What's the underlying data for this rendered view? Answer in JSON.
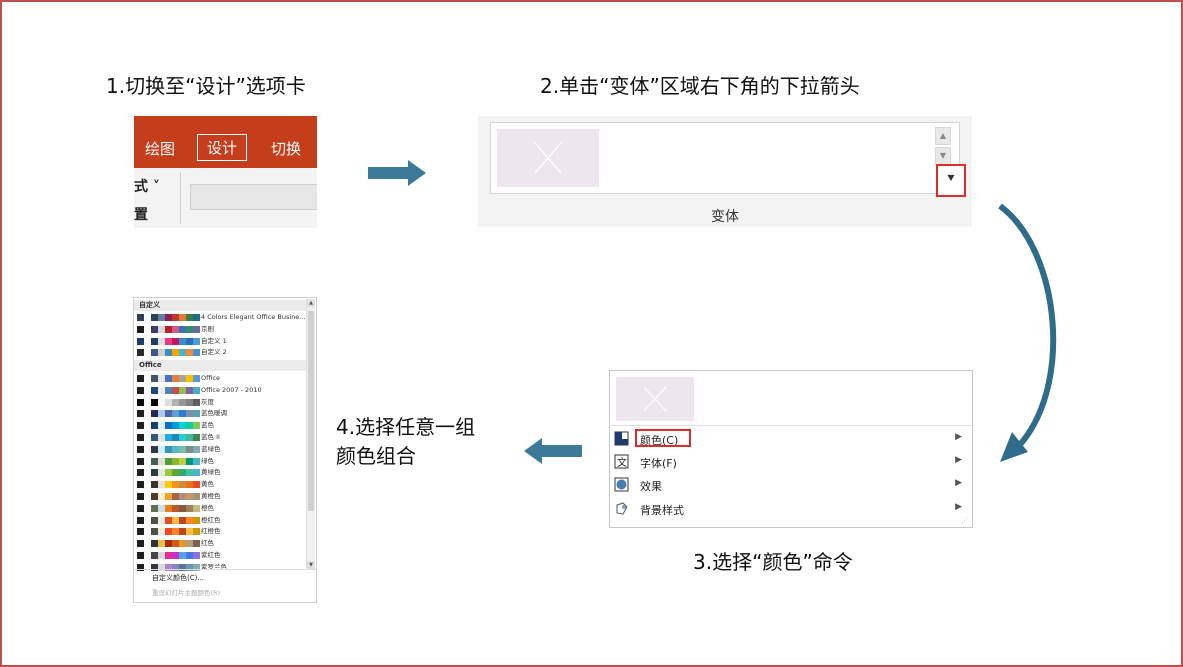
{
  "steps": {
    "s1": "1.切换至“设计”选项卡",
    "s2": "2.单击“变体”区域右下角的下拉箭头",
    "s3": "3.选择“颜色”命令",
    "s4_line1": "4.选择任意一组",
    "s4_line2": "颜色组合"
  },
  "ribbon": {
    "tab_draw": "绘图",
    "tab_design": "设计",
    "tab_transition": "切换",
    "lower_label1": "式 ˅",
    "lower_label2": "置"
  },
  "variants": {
    "group_label": "变体",
    "more_glyph": "⯆"
  },
  "menu": {
    "items": [
      {
        "label": "颜色(C)",
        "icon": "color-palette-icon"
      },
      {
        "label": "字体(F)",
        "icon": "font-icon"
      },
      {
        "label": "效果",
        "icon": "effects-icon"
      },
      {
        "label": "背景样式",
        "icon": "background-style-icon"
      }
    ]
  },
  "colors": {
    "header_custom": "自定义",
    "header_office": "Office",
    "custom": [
      {
        "name": "4 Colors Elegant Office Busine...",
        "sw": [
          "#2e4057",
          "#ffffff",
          "#2e4057",
          "#5b7fa6",
          "#8b2252",
          "#c0392b",
          "#e07b39",
          "#3a7d44",
          "#1f6f8b"
        ]
      },
      {
        "name": "京剧",
        "sw": [
          "#1c1c1c",
          "#ffffff",
          "#3d3d6b",
          "#d9d9d9",
          "#b5222b",
          "#d45a8c",
          "#3f6fae",
          "#2f8f66",
          "#6b6b9e"
        ]
      },
      {
        "name": "自定义 1",
        "sw": [
          "#1f3b6b",
          "#ffffff",
          "#1f3b6b",
          "#e0e0e0",
          "#e53b86",
          "#c2185b",
          "#3b8bd1",
          "#2c6fb8",
          "#4f9bd8"
        ]
      },
      {
        "name": "自定义 2",
        "sw": [
          "#2a2a2a",
          "#ffffff",
          "#3b5a8a",
          "#cfcfcf",
          "#3c8dbc",
          "#f0a500",
          "#4bb3c8",
          "#ef8b3b",
          "#4a8fd1"
        ]
      }
    ],
    "office": [
      {
        "name": "Office",
        "sw": [
          "#1f1f1f",
          "#ffffff",
          "#44546a",
          "#e7e6e6",
          "#4472c4",
          "#ed7d31",
          "#a5a5a5",
          "#ffc000",
          "#5b9bd5"
        ]
      },
      {
        "name": "Office 2007 - 2010",
        "sw": [
          "#1f1f1f",
          "#ffffff",
          "#1f497d",
          "#eeece1",
          "#4f81bd",
          "#c0504d",
          "#9bbb59",
          "#8064a2",
          "#4bacc6"
        ]
      },
      {
        "name": "灰度",
        "sw": [
          "#000000",
          "#ffffff",
          "#000000",
          "#f8f8f8",
          "#dddddd",
          "#b2b2b2",
          "#969696",
          "#808080",
          "#5f5f5f"
        ]
      },
      {
        "name": "蓝色暖调",
        "sw": [
          "#1f1f1f",
          "#ffffff",
          "#242852",
          "#acccea",
          "#4a66ac",
          "#629dd1",
          "#297fd5",
          "#7f8fa9",
          "#5aa2ae"
        ]
      },
      {
        "name": "蓝色",
        "sw": [
          "#1f1f1f",
          "#ffffff",
          "#17406d",
          "#dbeff9",
          "#0f6fc6",
          "#009dd9",
          "#0bd0d9",
          "#10cf9b",
          "#7cca62"
        ]
      },
      {
        "name": "蓝色 II",
        "sw": [
          "#1f1f1f",
          "#ffffff",
          "#335b74",
          "#dfe3e5",
          "#1cade4",
          "#2683c6",
          "#27ced7",
          "#42ba97",
          "#3e8853"
        ]
      },
      {
        "name": "蓝绿色",
        "sw": [
          "#1f1f1f",
          "#ffffff",
          "#373545",
          "#ceedfc",
          "#3494ba",
          "#58b6c0",
          "#75bda7",
          "#7a8c8e",
          "#84acb6"
        ]
      },
      {
        "name": "绿色",
        "sw": [
          "#1f1f1f",
          "#ffffff",
          "#455f51",
          "#e3ded1",
          "#549e39",
          "#8ab833",
          "#c0cf3a",
          "#029676",
          "#4ab5c4"
        ]
      },
      {
        "name": "黄绿色",
        "sw": [
          "#1f1f1f",
          "#ffffff",
          "#2c3c43",
          "#e5e8de",
          "#99cb38",
          "#63a537",
          "#37a76f",
          "#44c1a3",
          "#4eb3cf"
        ]
      },
      {
        "name": "黄色",
        "sw": [
          "#1f1f1f",
          "#ffffff",
          "#39302a",
          "#e5dedb",
          "#ffca08",
          "#f8931d",
          "#ce8d3e",
          "#ec7016",
          "#e64823"
        ]
      },
      {
        "name": "黄橙色",
        "sw": [
          "#1f1f1f",
          "#ffffff",
          "#4e3b30",
          "#fbeec9",
          "#f0a22e",
          "#a5644e",
          "#b58b80",
          "#c3986d",
          "#a19574"
        ]
      },
      {
        "name": "橙色",
        "sw": [
          "#1f1f1f",
          "#ffffff",
          "#637052",
          "#ccddea",
          "#e48312",
          "#bd582c",
          "#865640",
          "#9b8357",
          "#c2bc80"
        ]
      },
      {
        "name": "橙红色",
        "sw": [
          "#1f1f1f",
          "#ffffff",
          "#505046",
          "#eeece1",
          "#e84c22",
          "#ffbd47",
          "#b64926",
          "#ff8427",
          "#cc9900"
        ]
      },
      {
        "name": "红橙色",
        "sw": [
          "#1f1f1f",
          "#ffffff",
          "#505046",
          "#eeece1",
          "#e84c22",
          "#ff8427",
          "#b64926",
          "#ffbd47",
          "#cc9900"
        ]
      },
      {
        "name": "红色",
        "sw": [
          "#1f1f1f",
          "#ffffff",
          "#323232",
          "#e5c243",
          "#a5300f",
          "#d55816",
          "#e19825",
          "#b19c7d",
          "#7f5f52"
        ]
      },
      {
        "name": "紫红色",
        "sw": [
          "#1f1f1f",
          "#ffffff",
          "#454551",
          "#d8d9dc",
          "#e32d91",
          "#c830cc",
          "#4ea6dc",
          "#4775e7",
          "#8971e1"
        ]
      },
      {
        "name": "紫罗兰色",
        "sw": [
          "#1f1f1f",
          "#ffffff",
          "#373545",
          "#dcd8dc",
          "#ad84c6",
          "#8784c7",
          "#5d739a",
          "#6997af",
          "#84acb6"
        ]
      }
    ],
    "footer_custom": "自定义颜色(C)...",
    "footer_reset": "重设幻灯片主题颜色(R)"
  }
}
